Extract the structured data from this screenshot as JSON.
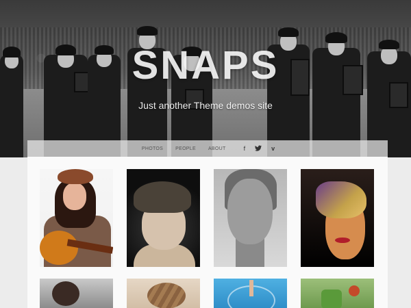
{
  "site": {
    "title": "SNAPS",
    "tagline": "Just another Theme demos site"
  },
  "nav": {
    "items": [
      {
        "label": "PHOTOS"
      },
      {
        "label": "PEOPLE"
      },
      {
        "label": "ABOUT"
      }
    ],
    "social": [
      {
        "icon": "facebook-icon",
        "glyph": "f"
      },
      {
        "icon": "twitter-icon",
        "glyph": "🐦"
      },
      {
        "icon": "vimeo-icon",
        "glyph": "v"
      }
    ]
  },
  "gallery": {
    "items": [
      {
        "subject": "girl-with-guitar"
      },
      {
        "subject": "child-with-cap"
      },
      {
        "subject": "woman-portrait"
      },
      {
        "subject": "masquerade-woman"
      },
      {
        "subject": "woman-portrait-2"
      },
      {
        "subject": "braided-hair"
      },
      {
        "subject": "swimmer-water"
      },
      {
        "subject": "cups-table"
      }
    ]
  },
  "colors": {
    "page_bg": "#ececec",
    "content_bg": "#fafafa",
    "nav_text": "#555555"
  }
}
